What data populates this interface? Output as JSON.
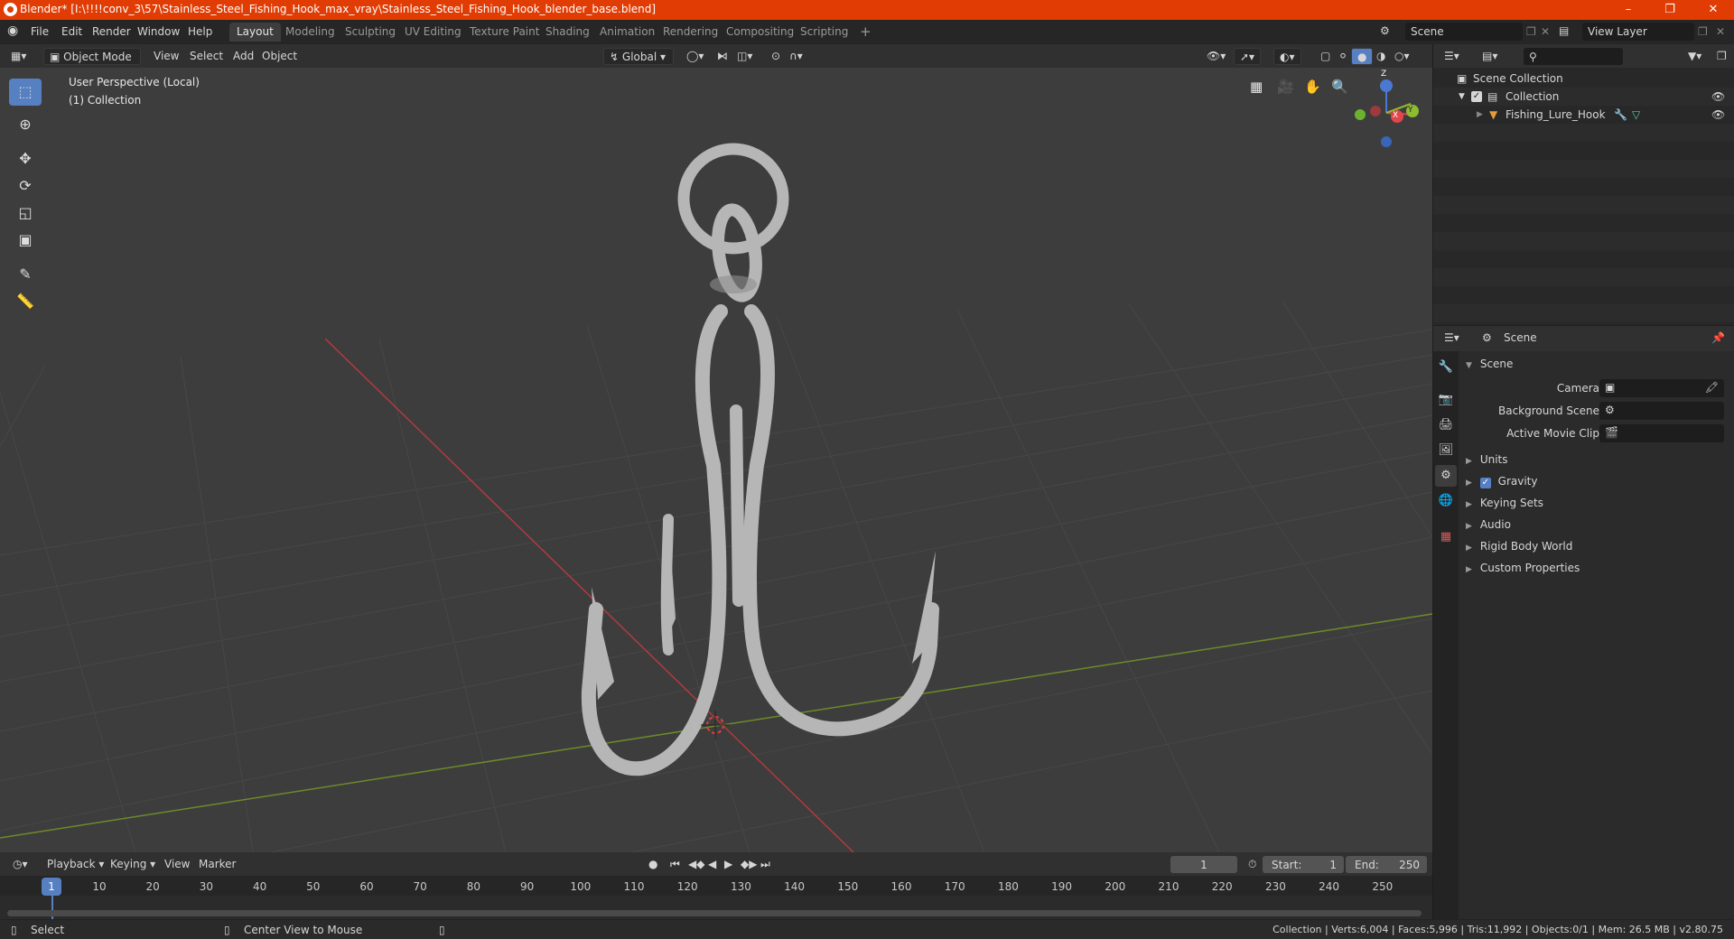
{
  "titlebar": {
    "title": "Blender* [I:\\!!!!conv_3\\57\\Stainless_Steel_Fishing_Hook_max_vray\\Stainless_Steel_Fishing_Hook_blender_base.blend]",
    "minimize": "–",
    "maximize": "❐",
    "close": "✕"
  },
  "menu": {
    "items": [
      "File",
      "Edit",
      "Render",
      "Window",
      "Help"
    ],
    "workspaces": [
      "Layout",
      "Modeling",
      "Sculpting",
      "UV Editing",
      "Texture Paint",
      "Shading",
      "Animation",
      "Rendering",
      "Compositing",
      "Scripting"
    ],
    "active_workspace": "Layout",
    "add_tab": "+",
    "scene_field": "Scene",
    "view_layer_field": "View Layer"
  },
  "viewport_header": {
    "mode": "Object Mode",
    "menus": [
      "View",
      "Select",
      "Add",
      "Object"
    ],
    "orientation": "Global"
  },
  "viewport": {
    "perspective": "User Perspective (Local)",
    "collection": "(1) Collection",
    "gizmo_axes": [
      "Z",
      "Y",
      "X"
    ]
  },
  "timeline": {
    "menus": [
      "Playback",
      "Keying",
      "View",
      "Marker"
    ],
    "current_frame": "1",
    "start_label": "Start:",
    "start_value": "1",
    "end_label": "End:",
    "end_value": "250",
    "ticks": [
      "1",
      "10",
      "20",
      "30",
      "40",
      "50",
      "60",
      "70",
      "80",
      "90",
      "100",
      "110",
      "120",
      "130",
      "140",
      "150",
      "160",
      "170",
      "180",
      "190",
      "200",
      "210",
      "220",
      "230",
      "240",
      "250"
    ]
  },
  "statusbar": {
    "left": "Select",
    "middle": "Center View to Mouse",
    "right": "Collection | Verts:6,004 | Faces:5,996 | Tris:11,992 | Objects:0/1 | Mem: 26.5 MB | v2.80.75"
  },
  "outliner": {
    "root": "Scene Collection",
    "collection": "Collection",
    "object": "Fishing_Lure_Hook"
  },
  "properties": {
    "header": "Scene",
    "section": "Scene",
    "camera_label": "Camera",
    "background_label": "Background Scene",
    "movieclip_label": "Active Movie Clip",
    "panels": [
      "Units",
      "Gravity",
      "Keying Sets",
      "Audio",
      "Rigid Body World",
      "Custom Properties"
    ]
  },
  "colors": {
    "titlebar": "#e03c04",
    "accent": "#5680c2",
    "x_axis": "#e0464a",
    "y_axis": "#8fbc2f",
    "z_axis": "#4a78d2"
  }
}
